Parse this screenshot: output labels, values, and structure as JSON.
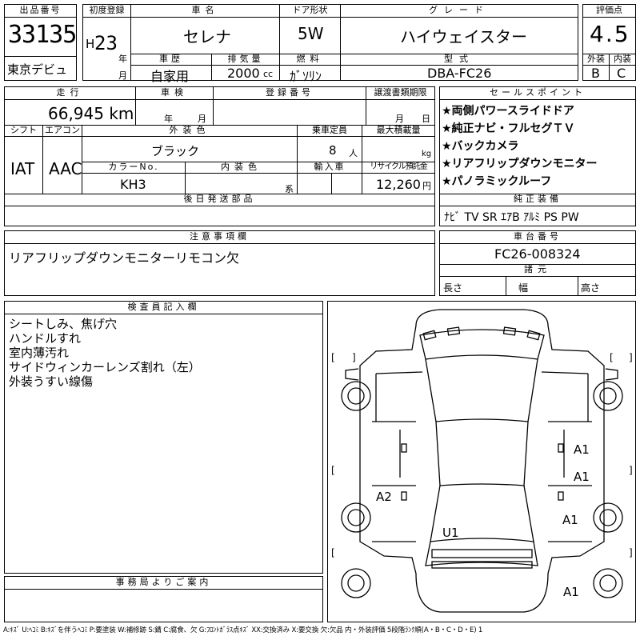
{
  "lot": {
    "label": "出品番号",
    "value": "33135",
    "venue": "東京デビュ"
  },
  "first_reg": {
    "label": "初度登録",
    "era": "H",
    "year": "23",
    "year_unit": "年",
    "month_unit": "月"
  },
  "car_name": {
    "label": "車名",
    "value": "セレナ"
  },
  "door": {
    "label": "ドア形状",
    "value": "5W"
  },
  "grade": {
    "label": "グレード",
    "value": "ハイウェイスター"
  },
  "score": {
    "label": "評価点",
    "value": "4.5",
    "ext_label": "外装",
    "int_label": "内装",
    "ext": "B",
    "int": "C"
  },
  "history": {
    "label": "車歴",
    "value": "自家用"
  },
  "displacement": {
    "label": "排気量",
    "value": "2000",
    "unit": "cc"
  },
  "fuel": {
    "label": "燃料",
    "value": "ｶﾞｿﾘﾝ"
  },
  "model": {
    "label": "型式",
    "value": "DBA-FC26"
  },
  "mileage": {
    "label": "走行",
    "value": "66,945 km"
  },
  "inspection": {
    "label": "車検",
    "year_unit": "年",
    "month_unit": "月"
  },
  "reg_no": {
    "label": "登録番号"
  },
  "transfer": {
    "label": "譲渡書類期限",
    "month_unit": "月",
    "day_unit": "日"
  },
  "shift": {
    "label": "シフト",
    "value": "IAT"
  },
  "ac": {
    "label": "エアコン",
    "value": "AAC"
  },
  "ext_color": {
    "label": "外装色",
    "value": "ブラック"
  },
  "capacity": {
    "label": "乗車定員",
    "value": "8",
    "unit": "人"
  },
  "max_load": {
    "label": "最大積載量",
    "unit": "kg"
  },
  "color_no": {
    "label": "カラーNo.",
    "value": "KH3"
  },
  "int_color": {
    "label": "内装色",
    "suffix": "系"
  },
  "import": {
    "label": "輸入車"
  },
  "recycle": {
    "label": "リサイクル預託金",
    "value": "12,260",
    "unit": "円"
  },
  "later_parts": {
    "label": "後日発送部品"
  },
  "sales_points": {
    "label": "セールスポイント",
    "items": [
      "★両側パワースライドドア",
      "★純正ナビ・フルセグＴＶ",
      "★バックカメラ",
      "★リアフリップダウンモニター",
      "★パノラミックルーフ"
    ]
  },
  "equipment": {
    "label": "純正装備",
    "value": "ﾅﾋﾞ TV SR ｴｱB ｱﾙﾐ PS PW"
  },
  "notes": {
    "label": "注意事項欄",
    "value": "リアフリップダウンモニターリモコン欠"
  },
  "chassis": {
    "label": "車台番号",
    "value": "FC26-008324"
  },
  "dims": {
    "label": "諸元",
    "length": "長さ",
    "width": "幅",
    "height": "高さ"
  },
  "inspector": {
    "label": "検査員記入欄",
    "lines": [
      "シートしみ、焦げ穴",
      "ハンドルすれ",
      "室内薄汚れ",
      "サイドウィンカーレンズ割れ（左）",
      "外装うすい線傷"
    ]
  },
  "office": {
    "label": "事務局よりご案内"
  },
  "diagram": {
    "marks": [
      "A1",
      "A1",
      "A2",
      "A1",
      "U1",
      "A1"
    ],
    "bracket_open": "[",
    "bracket_close": "]"
  },
  "legend": "A:ｷｽﾞ U:ﾍｺﾐ B:ｷｽﾞを伴うﾍｺﾐ P:要塗装 W:補修跡 S:錆 C:腐食、欠 G:ﾌﾛﾝﾄｶﾞﾗｽ点ｷｽﾞ XX:交換済み X:要交換 欠:欠品 内・外装評価 5段階ﾗﾝｸ順(A・B・C・D・E) 1"
}
